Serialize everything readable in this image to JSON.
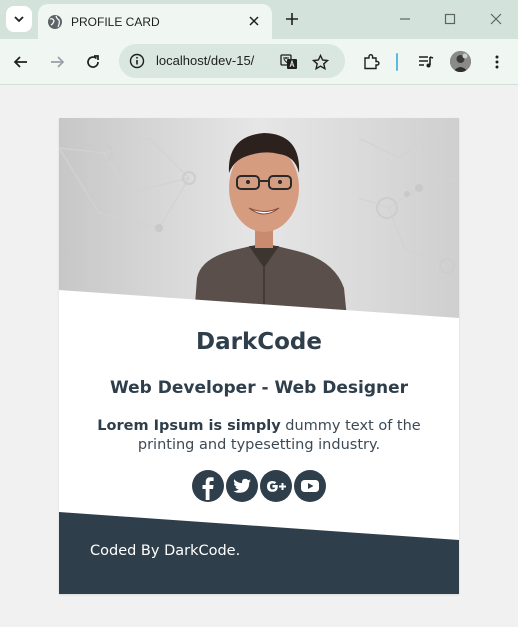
{
  "browser": {
    "tab_title": "PROFILE CARD",
    "url": "localhost/dev-15/"
  },
  "card": {
    "name": "DarkCode",
    "role": "Web Developer - Web Designer",
    "description_bold": "Lorem Ipsum is simply",
    "description_rest": " dummy text of the printing and typesetting industry.",
    "socials": [
      "facebook-icon",
      "twitter-icon",
      "google-plus-icon",
      "youtube-icon"
    ],
    "footer": "Coded By DarkCode."
  },
  "colors": {
    "dark": "#2f3e4b",
    "tabbar": "#d3e3dc",
    "toolbar": "#f0f7f3"
  }
}
